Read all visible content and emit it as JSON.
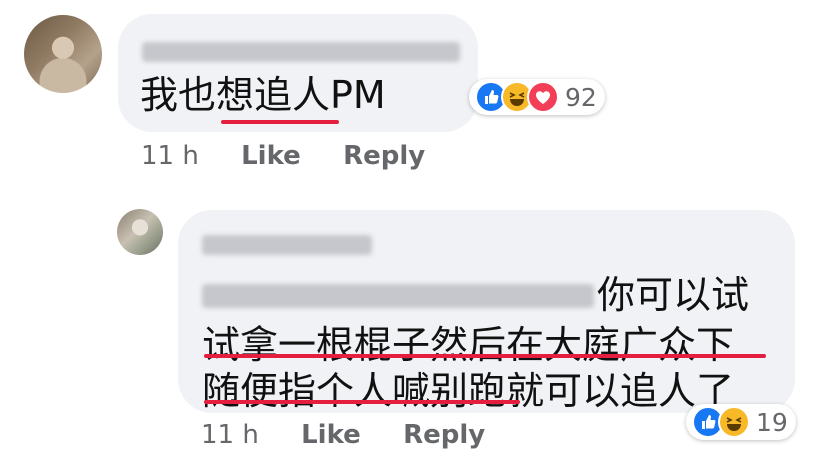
{
  "comment1": {
    "text": "我也想追人PM",
    "reactions": {
      "icons": [
        "like-icon",
        "haha-icon",
        "love-icon"
      ],
      "count": "92"
    },
    "time": "11 h",
    "like_label": "Like",
    "reply_label": "Reply"
  },
  "comment2": {
    "line1": "你可以试",
    "line2": "试拿一根棍子然后在大庭广众下",
    "line3": "随便指个人喊别跑就可以追人了",
    "reactions": {
      "icons": [
        "like-icon",
        "haha-icon"
      ],
      "count": "19"
    },
    "time": "11 h",
    "like_label": "Like",
    "reply_label": "Reply"
  },
  "colors": {
    "bubble": "#f0f2f5",
    "underline": "#e41e3f",
    "meta_text": "#65676b",
    "like": "#1877f2",
    "haha": "#f7b928",
    "love": "#f33e58"
  }
}
